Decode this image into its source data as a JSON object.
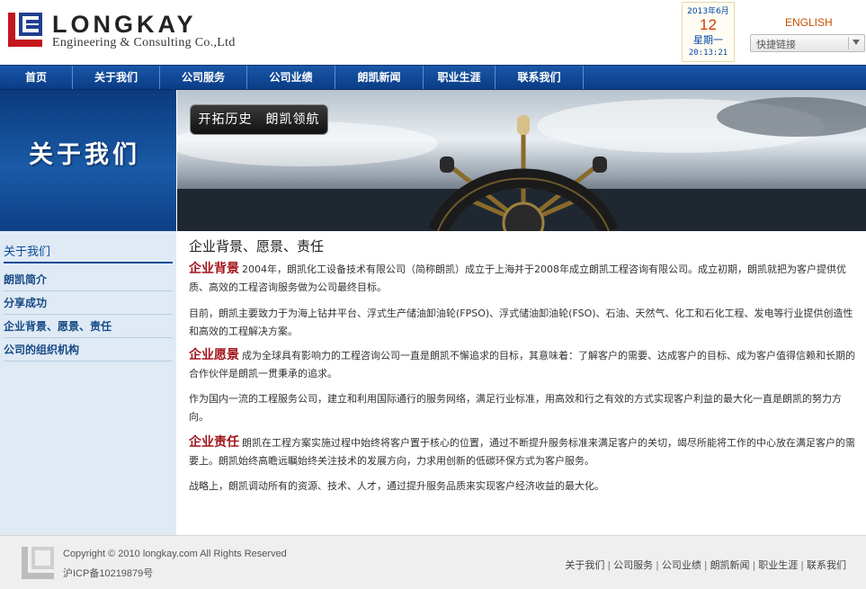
{
  "header": {
    "brand": "LONGKAY",
    "subtitle": "Engineering & Consulting Co.,Ltd",
    "calendar": {
      "year_month": "2013年6月",
      "day": "12",
      "weekday": "星期一",
      "time": "20:13:21"
    },
    "english_link": "ENGLISH",
    "quick_links_label": "快捷链接"
  },
  "nav": {
    "items": [
      "首页",
      "关于我们",
      "公司服务",
      "公司业绩",
      "朗凯新闻",
      "职业生涯",
      "联系我们"
    ]
  },
  "banner": {
    "section_title": "关于我们",
    "slogan": "开拓历史　朗凯领航"
  },
  "sidebar": {
    "heading": "关于我们",
    "items": [
      "朗凯简介",
      "分享成功",
      "企业背景、愿景、责任",
      "公司的组织机构"
    ]
  },
  "main": {
    "title": "企业背景、愿景、责任",
    "p1_label": "企业背景",
    "p1_text": "2004年，朗凯化工设备技术有限公司（简称朗凯）成立于上海并于2008年成立朗凯工程咨询有限公司。成立初期，朗凯就把为客户提供优质、高效的工程咨询服务做为公司最终目标。",
    "p2_text": "目前，朗凯主要致力于为海上钻井平台、浮式生产储油卸油轮(FPSO)、浮式储油卸油轮(FSO)、石油、天然气、化工和石化工程、发电等行业提供创造性和高效的工程解决方案。",
    "p3_label": "企业愿景",
    "p3_text": "成为全球具有影响力的工程咨询公司一直是朗凯不懈追求的目标，其意味着：了解客户的需要、达成客户的目标、成为客户值得信赖和长期的合作伙伴是朗凯一贯秉承的追求。",
    "p4_text": "作为国内一流的工程服务公司，建立和利用国际通行的服务网络，满足行业标准，用高效和行之有效的方式实现客户利益的最大化一直是朗凯的努力方向。",
    "p5_label": "企业责任",
    "p5_text": "朗凯在工程方案实施过程中始终将客户置于核心的位置，通过不断提升服务标准来满足客户的关切，竭尽所能将工作的中心放在满足客户的需要上。朗凯始终高瞻远瞩始终关注技术的发展方向，力求用创新的低碳环保方式为客户服务。",
    "p6_text": "战略上，朗凯调动所有的资源、技术、人才，通过提升服务品质来实现客户经济收益的最大化。"
  },
  "footer": {
    "copyright": "Copyright © 2010 longkay.com All Rights Reserved",
    "icp": "沪ICP备10219879号",
    "links": [
      "关于我们",
      "公司服务",
      "公司业绩",
      "朗凯新闻",
      "职业生涯",
      "联系我们"
    ],
    "separator": "|"
  },
  "colors": {
    "nav_blue": "#0f4797",
    "accent_red": "#a3151c",
    "sidebar_bg": "#dfeaf5"
  }
}
